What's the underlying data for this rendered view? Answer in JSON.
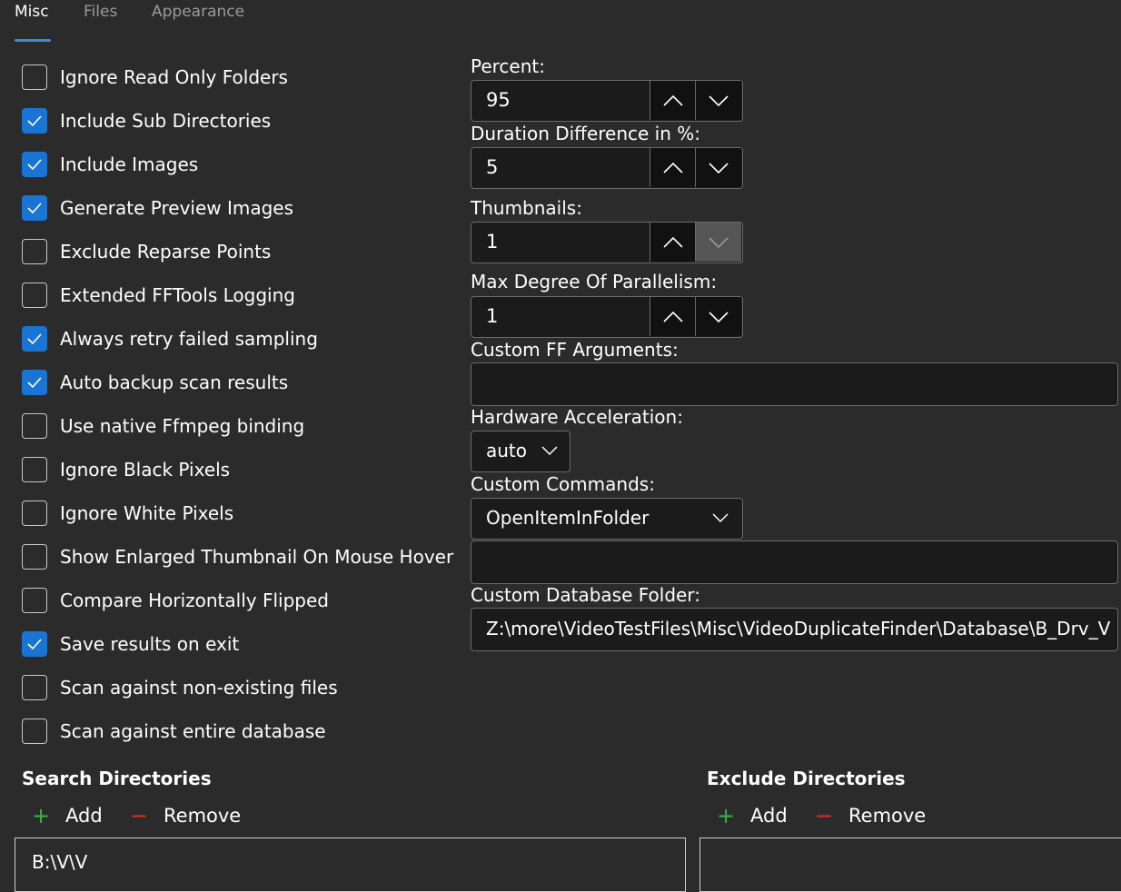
{
  "tabs": [
    "Misc",
    "Files",
    "Appearance"
  ],
  "active_tab": "Misc",
  "checkboxes": [
    {
      "label": "Ignore Read Only Folders",
      "checked": false
    },
    {
      "label": "Include Sub Directories",
      "checked": true
    },
    {
      "label": "Include Images",
      "checked": true
    },
    {
      "label": "Generate Preview Images",
      "checked": true
    },
    {
      "label": "Exclude Reparse Points",
      "checked": false
    },
    {
      "label": "Extended FFTools Logging",
      "checked": false
    },
    {
      "label": "Always retry failed sampling",
      "checked": true
    },
    {
      "label": "Auto backup scan results",
      "checked": true
    },
    {
      "label": "Use native Ffmpeg binding",
      "checked": false
    },
    {
      "label": "Ignore Black Pixels",
      "checked": false
    },
    {
      "label": "Ignore White Pixels",
      "checked": false
    },
    {
      "label": "Show Enlarged Thumbnail On Mouse Hover",
      "checked": false
    },
    {
      "label": "Compare Horizontally Flipped",
      "checked": false
    },
    {
      "label": "Save results on exit",
      "checked": true
    },
    {
      "label": "Scan against non-existing files",
      "checked": false
    },
    {
      "label": "Scan against entire database",
      "checked": false
    }
  ],
  "settings": {
    "percent": {
      "label": "Percent:",
      "value": "95"
    },
    "duration": {
      "label": "Duration Difference in %:",
      "value": "5"
    },
    "thumbnails": {
      "label": "Thumbnails:",
      "value": "1"
    },
    "parallelism": {
      "label": "Max Degree Of Parallelism:",
      "value": "1"
    },
    "custom_ff": {
      "label": "Custom FF Arguments:",
      "value": ""
    },
    "hw_accel": {
      "label": "Hardware Acceleration:",
      "value": "auto"
    },
    "custom_commands": {
      "label": "Custom Commands:",
      "value": "OpenItemInFolder",
      "command_text": ""
    },
    "database_folder": {
      "label": "Custom Database Folder:",
      "value": "Z:\\more\\VideoTestFiles\\Misc\\VideoDuplicateFinder\\Database\\B_Drv_V"
    }
  },
  "search_directories": {
    "title": "Search Directories",
    "add_label": "Add",
    "remove_label": "Remove",
    "items": [
      "B:\\V\\V"
    ]
  },
  "exclude_directories": {
    "title": "Exclude Directories",
    "add_label": "Add",
    "remove_label": "Remove",
    "items": []
  },
  "colors": {
    "accent": "#1a74d4",
    "add": "#3cb043",
    "remove": "#d93025"
  }
}
